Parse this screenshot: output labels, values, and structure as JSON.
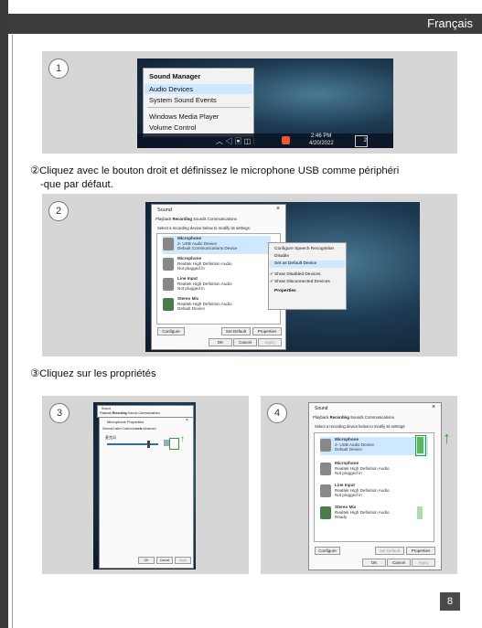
{
  "header": {
    "language": "Français"
  },
  "page_number": "8",
  "steps": [
    {
      "number": "1"
    },
    {
      "number": "2"
    },
    {
      "number": "3"
    },
    {
      "number": "4"
    }
  ],
  "captions": {
    "step2_line1": "②Cliquez avec le bouton droit et définissez le microphone USB comme périphéri",
    "step2_line2": "-que par défaut.",
    "step3": "③Cliquez sur les propriétés"
  },
  "sound_menu": {
    "title": "Sound Manager",
    "items": [
      "Audio Devices",
      "System Sound Events",
      "Windows Media Player",
      "Volume Control"
    ],
    "clock_time": "2:46 PM",
    "clock_date": "4/20/2022",
    "badge": "2"
  },
  "sound_dialog": {
    "title": "Sound",
    "tabs": [
      "Playback",
      "Recording",
      "Sounds",
      "Communications"
    ],
    "instruction": "Select a recording device below to modify its settings:",
    "devices": [
      {
        "name": "Microphone",
        "line1": "2- USB Audio Device",
        "line2": "Default Communications Device"
      },
      {
        "name": "Microphone",
        "line1": "Realtek High Definition Audio",
        "line2": "Not plugged in"
      },
      {
        "name": "Line Input",
        "line1": "Realtek High Definition Audio",
        "line2": "Not plugged in"
      },
      {
        "name": "Stereo Mix",
        "line1": "Realtek High Definition Audio",
        "line2": "Default Device"
      }
    ],
    "buttons": {
      "configure": "Configure",
      "set_default": "Set Default",
      "properties": "Properties",
      "ok": "OK",
      "cancel": "Cancel",
      "apply": "Apply"
    }
  },
  "context_menu": {
    "items": [
      "Configure Speech Recognition",
      "Disable",
      "Set as Default Device",
      "Show Disabled Devices",
      "Show Disconnected Devices",
      "Properties"
    ]
  },
  "props_dialog": {
    "title": "Microphone Properties",
    "tabs": [
      "General",
      "Listen",
      "Custom",
      "Levels",
      "Advanced"
    ],
    "level_label": "麦克风",
    "buttons": {
      "ok": "OK",
      "cancel": "Cancel",
      "apply": "Apply"
    }
  },
  "sound_dialog_4": {
    "title": "Sound",
    "tabs": [
      "Playback",
      "Recording",
      "Sounds",
      "Communications"
    ],
    "instruction": "Select a recording device below to modify its settings:",
    "devices": [
      {
        "name": "Microphone",
        "line1": "2- USB Audio Device",
        "line2": "Default Device"
      },
      {
        "name": "Microphone",
        "line1": "Realtek High Definition Audio",
        "line2": "Not plugged in"
      },
      {
        "name": "Line Input",
        "line1": "Realtek High Definition Audio",
        "line2": "Not plugged in"
      },
      {
        "name": "Stereo Mix",
        "line1": "Realtek High Definition Audio",
        "line2": "Ready"
      }
    ],
    "buttons": {
      "configure": "Configure",
      "set_default": "Set Default",
      "properties": "Properties",
      "ok": "OK",
      "cancel": "Cancel",
      "apply": "Apply"
    }
  },
  "colors": {
    "accent_green": "#2ca02c",
    "highlight": "#cde8ff",
    "header_bg": "#3d3d3d"
  }
}
